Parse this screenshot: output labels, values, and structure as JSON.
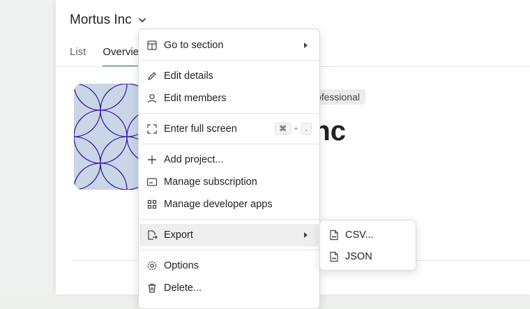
{
  "header": {
    "org_name": "Mortus Inc"
  },
  "tabs": [
    {
      "label": "List"
    },
    {
      "label": "Overview"
    }
  ],
  "profile": {
    "plan_badge": "Professional",
    "name": "Mortus Inc"
  },
  "context_menu": {
    "items": [
      {
        "label": "Go to section",
        "icon": "layout-icon"
      },
      {
        "label": "Edit details",
        "icon": "pencil-icon"
      },
      {
        "label": "Edit members",
        "icon": "person-icon"
      },
      {
        "label": "Enter full screen",
        "icon": "fullscreen-icon",
        "shortcut": [
          "⌘",
          "+",
          "."
        ]
      },
      {
        "label": "Add project...",
        "icon": "plus-icon"
      },
      {
        "label": "Manage subscription",
        "icon": "card-icon"
      },
      {
        "label": "Manage developer apps",
        "icon": "grid-icon"
      },
      {
        "label": "Export",
        "icon": "export-icon"
      },
      {
        "label": "Options",
        "icon": "gear-icon"
      },
      {
        "label": "Delete...",
        "icon": "trash-icon"
      }
    ]
  },
  "export_submenu": {
    "items": [
      {
        "label": "CSV...",
        "icon": "file-csv-icon"
      },
      {
        "label": "JSON",
        "icon": "file-json-icon"
      }
    ]
  },
  "colors": {
    "accent": "#1f7a4a",
    "avatar_bg": "#c8d6e6",
    "avatar_lines": "#3a14a8",
    "highlight": "#eeeeee"
  }
}
